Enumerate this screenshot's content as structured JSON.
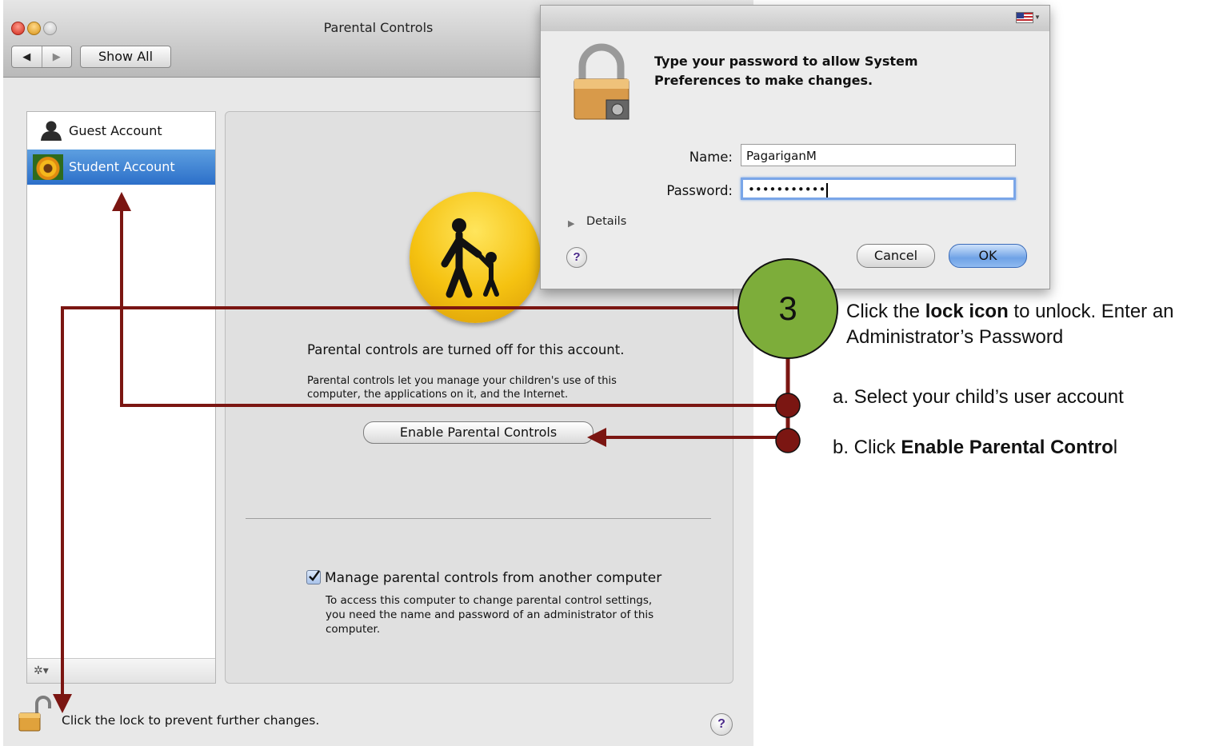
{
  "window": {
    "title": "Parental Controls",
    "nav_back": "◀",
    "nav_forward": "▶",
    "show_all_label": "Show All"
  },
  "sidebar": {
    "accounts": [
      {
        "label": "Guest Account",
        "icon": "person-silhouette-icon"
      },
      {
        "label": "Student Account",
        "icon": "flower-avatar-icon",
        "selected": true
      }
    ],
    "gear_label": "✲▾"
  },
  "content": {
    "status_text": "Parental controls are turned off for this account.",
    "description": "Parental controls let you manage your children's use of this computer, the applications on it, and the Internet.",
    "enable_button_label": "Enable Parental Controls",
    "manage_remote_label": "Manage parental controls from another computer",
    "manage_remote_checked": true,
    "manage_remote_description": "To access this computer to change parental control settings, you need the name and password of an administrator of this computer."
  },
  "footer": {
    "lock_text": "Click the lock to prevent further changes.",
    "help_label": "?"
  },
  "auth_dialog": {
    "message": "Type your password to allow System Preferences to make changes.",
    "name_label": "Name:",
    "name_value": "PagariganM",
    "password_label": "Password:",
    "password_value": "•••••••••••",
    "details_label": "Details",
    "help_label": "?",
    "cancel_label": "Cancel",
    "ok_label": "OK"
  },
  "annotation": {
    "step_number": "3",
    "instruction_prefix": "Click the ",
    "instruction_bold": "lock icon",
    "instruction_suffix": " to unlock. Enter an Administrator’s Password",
    "step_a": "a. Select your child’s user account",
    "step_b_prefix": "b. Click ",
    "step_b_bold": "Enable Parental Contro",
    "step_b_suffix": "l",
    "colors": {
      "arrow": "#7b1612",
      "badge_fill": "#7dad3a",
      "badge_border": "#111111"
    }
  }
}
